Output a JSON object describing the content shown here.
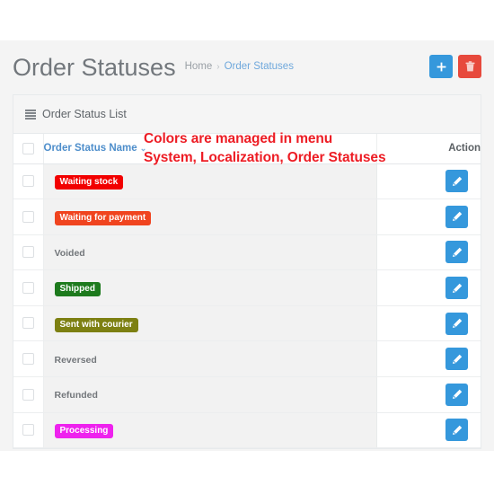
{
  "page": {
    "title": "Order Statuses",
    "breadcrumb": {
      "home": "Home",
      "separator": "›",
      "current": "Order Statuses"
    },
    "background_color": "#f4f4f4"
  },
  "header_actions": [
    {
      "name": "add-button",
      "icon": "plus-icon",
      "color": "#3598dc"
    },
    {
      "name": "delete-button",
      "icon": "trash-icon",
      "color": "#e7493c"
    }
  ],
  "panel": {
    "icon": "list-icon",
    "title": "Order Status List"
  },
  "annotation": {
    "line1": "Colors are managed in menu",
    "line2": "System, Localization, Order Statuses",
    "color": "#ed1c24"
  },
  "table": {
    "headers": {
      "select_all": "",
      "name": "Order Status Name",
      "sort_caret": "⌄",
      "action": "Action"
    },
    "action_icon": "pencil-icon",
    "action_button_color": "#3598dc",
    "rows": [
      {
        "name": "Waiting stock",
        "badge": true,
        "color": "#f20000"
      },
      {
        "name": "Waiting for payment",
        "badge": true,
        "color": "#f0441f"
      },
      {
        "name": "Voided",
        "badge": false,
        "color": ""
      },
      {
        "name": "Shipped",
        "badge": true,
        "color": "#1d7a1d"
      },
      {
        "name": "Sent with courier",
        "badge": true,
        "color": "#7d8012"
      },
      {
        "name": "Reversed",
        "badge": false,
        "color": ""
      },
      {
        "name": "Refunded",
        "badge": false,
        "color": ""
      },
      {
        "name": "Processing",
        "badge": true,
        "color": "#ee22ee"
      }
    ]
  }
}
